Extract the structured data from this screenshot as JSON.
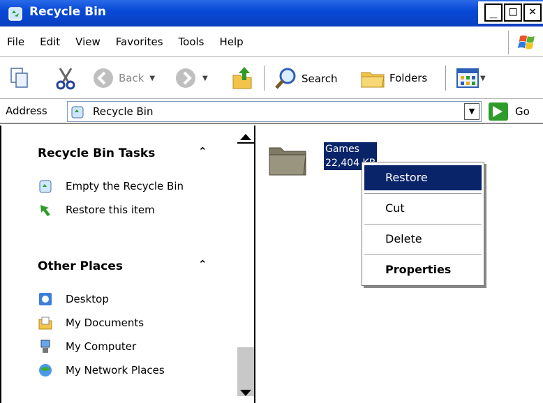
{
  "window": {
    "title": "Recycle Bin",
    "minimize_glyph": "_",
    "maximize_glyph": "□",
    "close_glyph": "×"
  },
  "menubar": {
    "items": [
      "File",
      "Edit",
      "View",
      "Favorites",
      "Tools",
      "Help"
    ]
  },
  "toolbar": {
    "back_label": "Back",
    "search_label": "Search",
    "folders_label": "Folders"
  },
  "address": {
    "label": "Address",
    "value": "Recycle Bin",
    "go_label": "Go"
  },
  "left_pane": {
    "recycle_tasks": {
      "title": "Recycle Bin Tasks",
      "items": [
        "Empty the Recycle Bin",
        "Restore this item"
      ]
    },
    "other_places": {
      "title": "Other Places",
      "items": [
        "Desktop",
        "My Documents",
        "My Computer",
        "My Network Places"
      ]
    },
    "collapse_glyph": "⌃"
  },
  "right_pane": {
    "item": {
      "name": "Games",
      "size": "22,404 KB"
    }
  },
  "context_menu": {
    "items": [
      {
        "label": "Restore",
        "active": true,
        "bold": false
      },
      {
        "label": "Cut",
        "active": false,
        "bold": false
      },
      {
        "label": "Delete",
        "active": false,
        "bold": false
      },
      {
        "label": "Properties",
        "active": false,
        "bold": true
      }
    ]
  },
  "colors": {
    "titlebar": "#0849d6",
    "selection": "#0a246a",
    "go_green": "#2f9b2a"
  }
}
